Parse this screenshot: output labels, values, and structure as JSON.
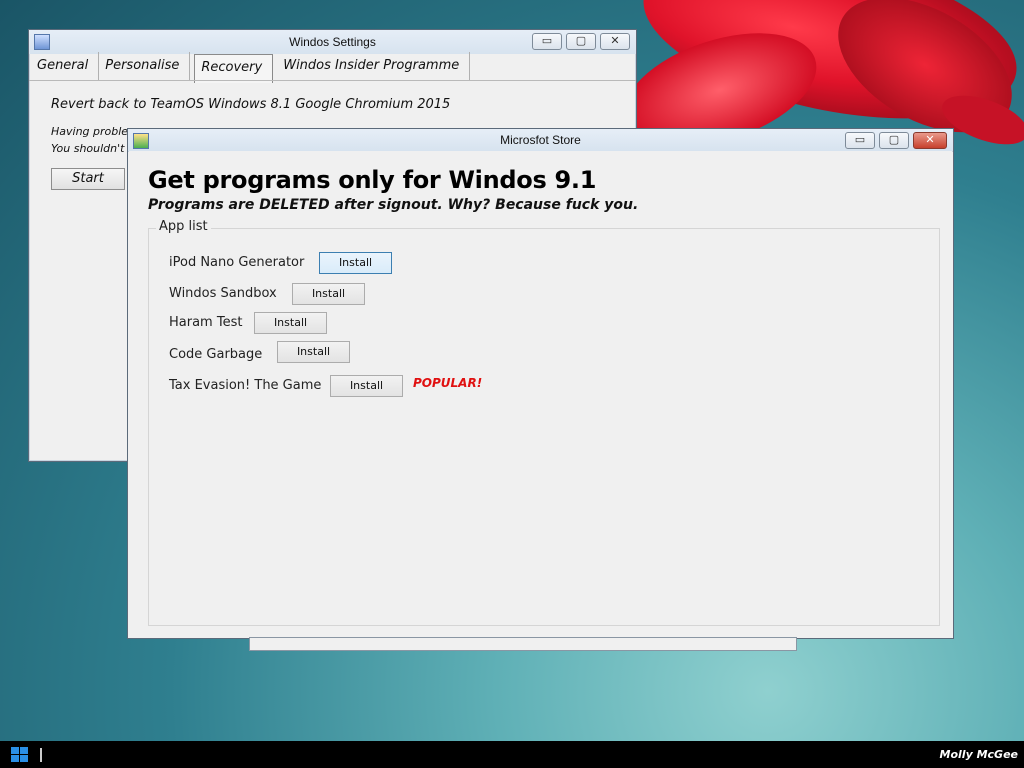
{
  "settings_window": {
    "title": "Windos Settings",
    "tabs": [
      {
        "label": "General"
      },
      {
        "label": "Personalise"
      },
      {
        "label": "Recovery"
      },
      {
        "label": "Windos Insider Programme"
      }
    ],
    "revert_text": "Revert back to TeamOS Windows 8.1 Google Chromium 2015",
    "line1": "Having proble",
    "line2": "You shouldn't",
    "start_button": "Start"
  },
  "store_window": {
    "title": "Microsfot Store",
    "headline": "Get programs only for Windos 9.1",
    "subline": "Programs are DELETED after signout. Why? Because fuck you.",
    "group_label": "App list",
    "apps": [
      {
        "name": "iPod Nano Generator",
        "button": "Install"
      },
      {
        "name": "Windos Sandbox",
        "button": "Install"
      },
      {
        "name": "Haram Test",
        "button": "Install"
      },
      {
        "name": "Code Garbage",
        "button": "Install"
      },
      {
        "name": "Tax Evasion! The Game",
        "button": "Install"
      }
    ],
    "popular_badge": "POPULAR!",
    "badge_color": "#e01010"
  },
  "window_controls": {
    "minimize": "▭",
    "maximize": "▢",
    "close": "✕"
  },
  "taskbar": {
    "user_name": "Molly McGee",
    "start_icon": "windows-logo-icon"
  }
}
